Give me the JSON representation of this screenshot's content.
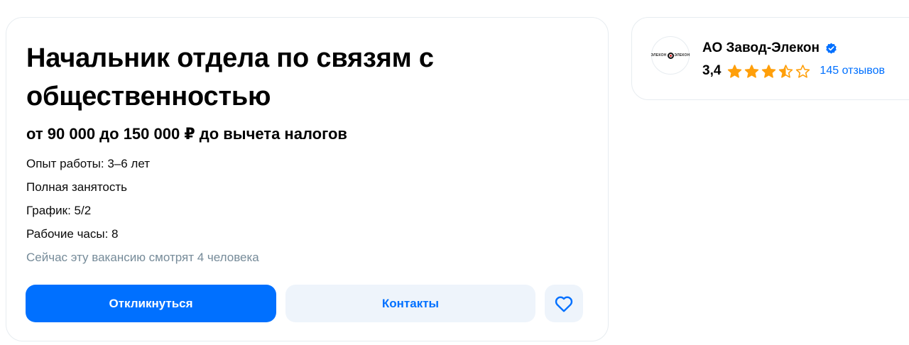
{
  "vacancy": {
    "title": "Начальник отдела по связям с общественностью",
    "salary": "от 90 000 до 150 000 ₽ до вычета налогов",
    "experience": "Опыт работы: 3–6 лет",
    "employment": "Полная занятость",
    "schedule": "График: 5/2",
    "working_hours": "Рабочие часы: 8",
    "viewers": "Сейчас эту вакансию смотрят 4 человека",
    "buttons": {
      "respond": "Откликнуться",
      "contacts": "Контакты",
      "favorite_icon": "heart-icon"
    }
  },
  "company": {
    "name": "АО Завод-Элекон",
    "verified_icon": "verified-check-icon",
    "logo_text_left": "ЭЛЕКОН",
    "logo_text_right": "ЭЛЕКОН",
    "rating": "3,4",
    "rating_value": 3.4,
    "stars_max": 5,
    "reviews": "145 отзывов"
  },
  "colors": {
    "accent": "#0070ff",
    "secondary_button_bg": "#eef4fb",
    "muted_text": "#768b99",
    "star": "#ff9f0a",
    "card_border": "#e7ecf0"
  }
}
